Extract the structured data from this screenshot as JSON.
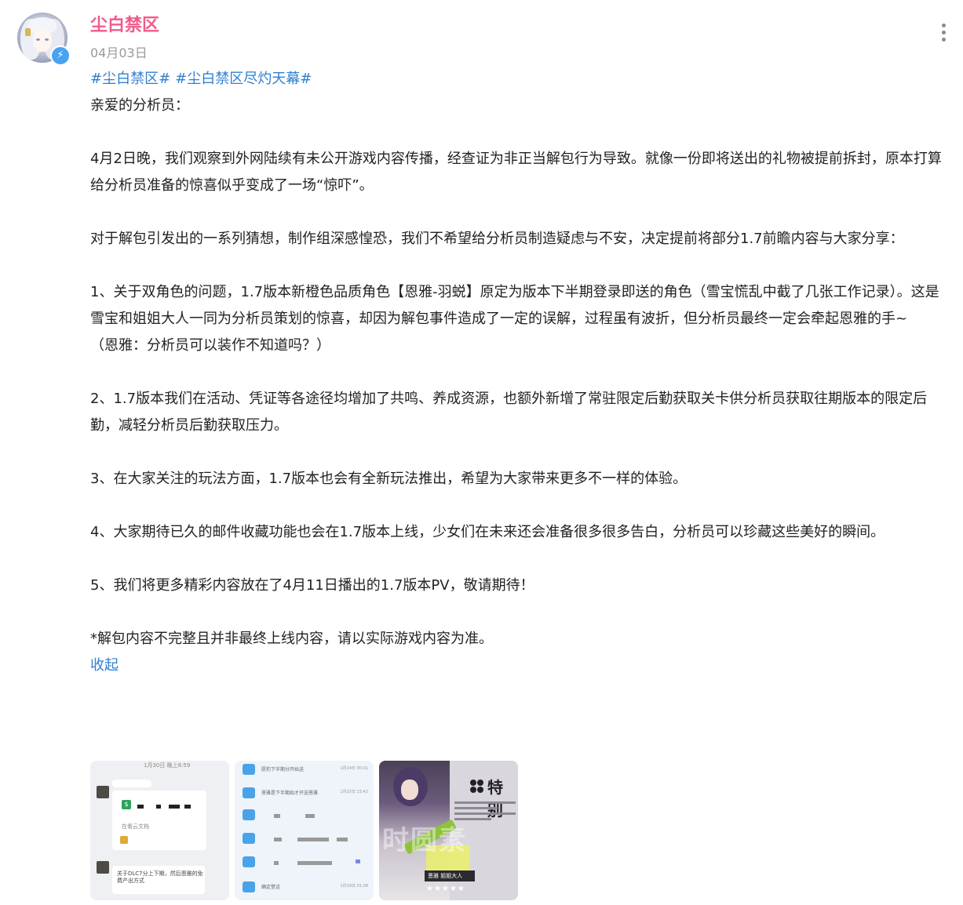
{
  "post": {
    "username": "尘白禁区",
    "date": "04月03日",
    "tags": [
      "#尘白禁区#",
      "#尘白禁区尽灼天幕#"
    ],
    "greeting": "亲爱的分析员：",
    "paragraphs": [
      "4月2日晚，我们观察到外网陆续有未公开游戏内容传播，经查证为非正当解包行为导致。就像一份即将送出的礼物被提前拆封，原本打算给分析员准备的惊喜似乎变成了一场“惊吓”。",
      "对于解包引发出的一系列猜想，制作组深感惶恐，我们不希望给分析员制造疑虑与不安，决定提前将部分1.7前瞻内容与大家分享："
    ],
    "item1": "1、关于双角色的问题，1.7版本新橙色品质角色【恩雅-羽蜕】原定为版本下半期登录即送的角色（雪宝慌乱中截了几张工作记录）。这是雪宝和姐姐大人一同为分析员策划的惊喜，却因为解包事件造成了一定的误解，过程虽有波折，但分析员最终一定会牵起恩雅的手~",
    "item1_note": "（恩雅：分析员可以装作不知道吗？）",
    "item2": "2、1.7版本我们在活动、凭证等各途径均增加了共鸣、养成资源，也额外新增了常驻限定后勤获取关卡供分析员获取往期版本的限定后勤，减轻分析员后勤获取压力。",
    "item3": "3、在大家关注的玩法方面，1.7版本也会有全新玩法推出，希望为大家带来更多不一样的体验。",
    "item4": "4、大家期待已久的邮件收藏功能也会在1.7版本上线，少女们在未来还会准备很多很多告白，分析员可以珍藏这些美好的瞬间。",
    "item5": "5、我们将更多精彩内容放在了4月11日播出的1.7版本PV，敬请期待！",
    "disclaimer": "*解包内容不完整且并非最终上线内容，请以实际游戏内容为准。",
    "fold_label": "收起"
  },
  "images": {
    "img1": {
      "timestamp": "1月30日 晚上8:59",
      "file_label": "在看云文档",
      "message": "关于DLC7分上下期，然后恩雅的免费产出方式"
    },
    "img2": {
      "rows": [
        {
          "text": "愿豹下半期分开始送",
          "time": "1月24日 00:01"
        },
        {
          "text": "恩雅是下半期始才开送恩雅",
          "time": "1月25日 23:42"
        },
        {
          "text": "",
          "time": ""
        },
        {
          "text": "",
          "time": ""
        },
        {
          "text": "",
          "time": ""
        },
        {
          "text": "",
          "time": ""
        },
        {
          "text": "确定登话",
          "time": "1月18日 01:08"
        }
      ]
    },
    "img3": {
      "title": "特别",
      "watermark": "时圆素",
      "nameplate": "恩雅 姐姐大人",
      "stars": "★★★★★"
    }
  },
  "colors": {
    "username": "#f25a8a",
    "link": "#2f7fd1",
    "date": "#9a9a9a",
    "badge": "#4aa3f0"
  },
  "icons": {
    "verified": "lightning-badge-icon",
    "more": "more-vertical-icon"
  }
}
